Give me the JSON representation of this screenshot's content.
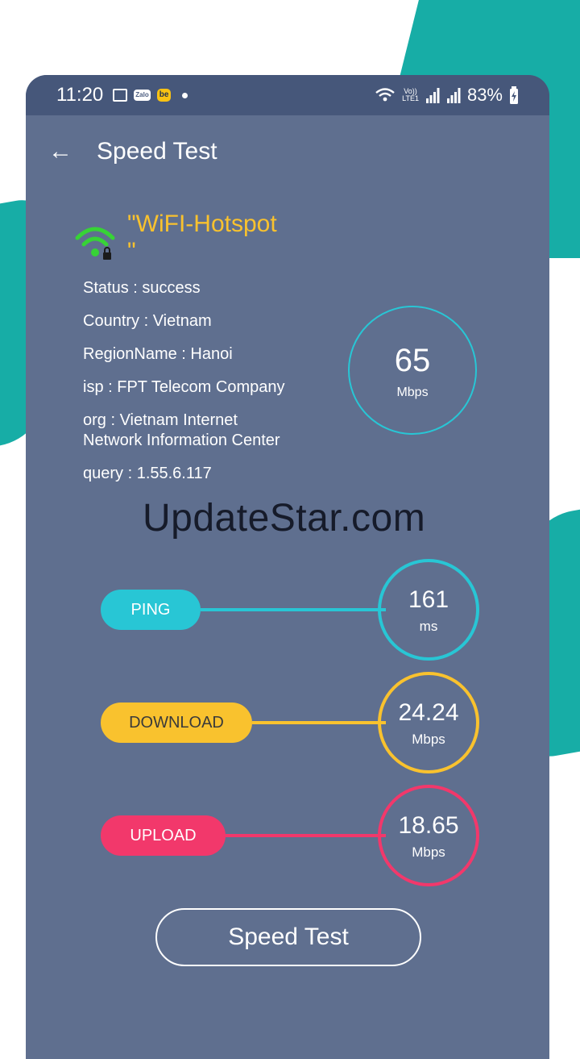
{
  "colors": {
    "teal_bg": "#17ADA6",
    "card": "#5F6F8F",
    "statusbar": "#46577A",
    "ssid": "#F9C22E",
    "ping": "#28C6D5",
    "download": "#F9C22E",
    "upload": "#F2386B"
  },
  "statusbar": {
    "time": "11:20",
    "zalo": "Zalo",
    "be": "be",
    "volte_top": "Vo))",
    "volte_bottom": "LTE1",
    "battery": "83%"
  },
  "appbar": {
    "back_icon": "arrow-left",
    "title": "Speed Test"
  },
  "network": {
    "ssid_line1": "\"WiFI-Hotspot",
    "ssid_line2": "\"",
    "status": "Status : success",
    "country": "Country : Vietnam",
    "region": "RegionName : Hanoi",
    "isp": "isp : FPT Telecom Company",
    "org": "org : Vietnam Internet Network Information Center",
    "query": "query : 1.55.6.117"
  },
  "speed": {
    "value": "65",
    "unit": "Mbps"
  },
  "metrics": {
    "ping": {
      "label": "PING",
      "value": "161",
      "unit": "ms"
    },
    "download": {
      "label": "DOWNLOAD",
      "value": "24.24",
      "unit": "Mbps"
    },
    "upload": {
      "label": "UPLOAD",
      "value": "18.65",
      "unit": "Mbps"
    }
  },
  "watermark": "UpdateStar.com",
  "button": {
    "label": "Speed Test"
  }
}
